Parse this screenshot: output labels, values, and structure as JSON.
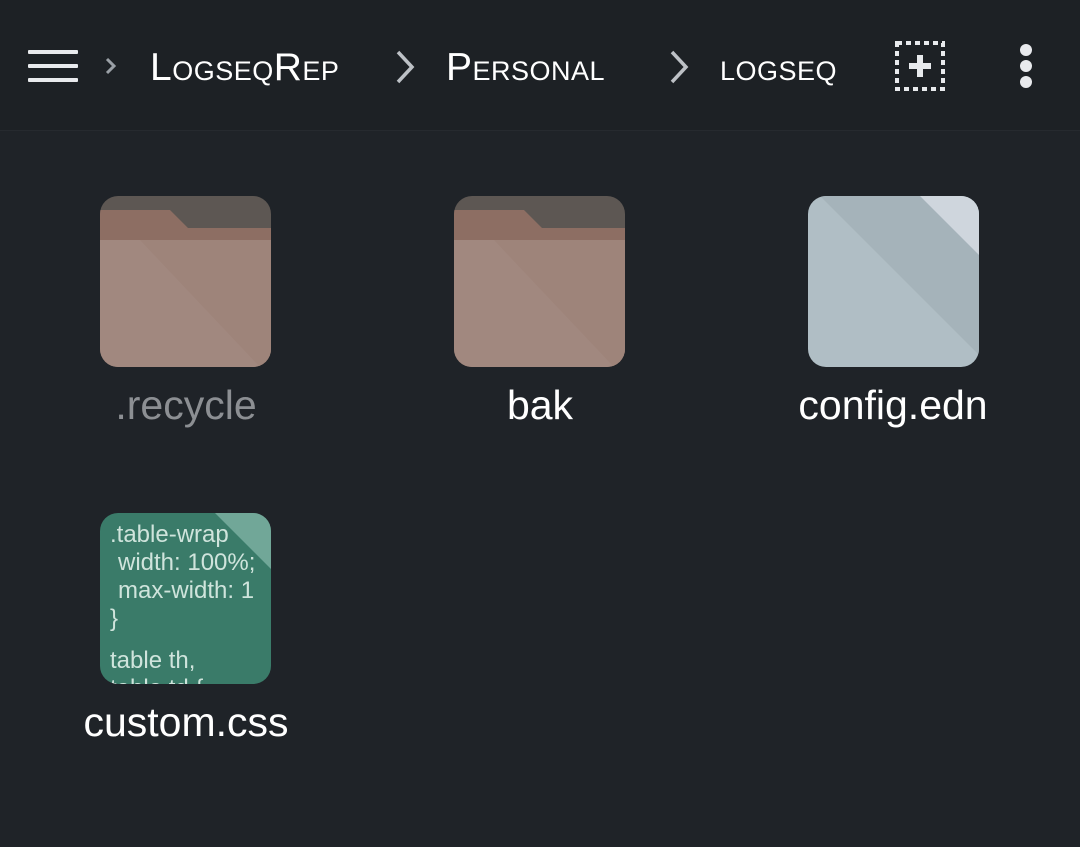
{
  "toolbar": {
    "breadcrumbs": [
      {
        "label": "LogseqRep"
      },
      {
        "label": "Personal"
      },
      {
        "label": "logseq"
      }
    ],
    "icons": {
      "menu": "hamburger-menu-icon",
      "select": "add-selection-icon",
      "more": "more-vert-icon"
    }
  },
  "files": [
    {
      "name": ".recycle",
      "type": "folder",
      "dimmed": true
    },
    {
      "name": "bak",
      "type": "folder",
      "dimmed": false
    },
    {
      "name": "config.edn",
      "type": "file",
      "dimmed": false
    },
    {
      "name": "custom.css",
      "type": "css",
      "dimmed": false,
      "preview_lines": [
        ".table-wrap",
        " width: 100%;",
        " max-width: 1",
        "}",
        "table th,",
        "table td {"
      ]
    }
  ],
  "colors": {
    "background": "#1f2328",
    "folder": "#a1887f",
    "folder_tab": "#8d6e63",
    "file": "#b0bec5",
    "css_tile": "#3a7b69",
    "dim_label": "#8c8f93"
  }
}
